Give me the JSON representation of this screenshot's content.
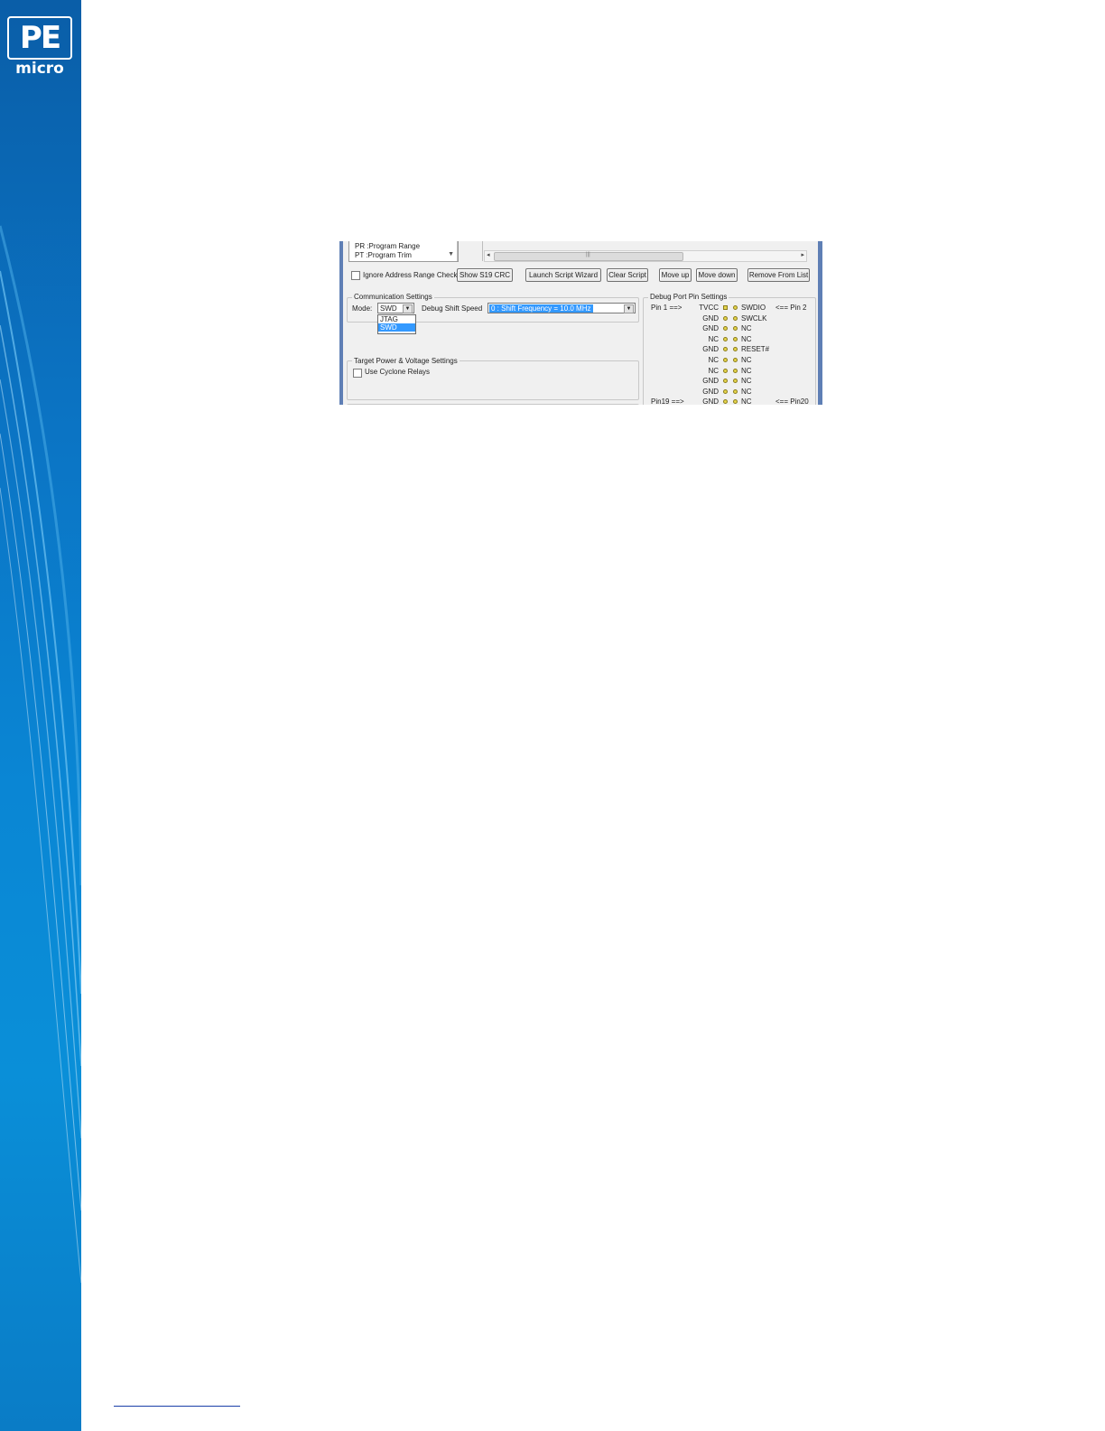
{
  "logo": {
    "top": "PE",
    "bottom": "micro"
  },
  "dialog": {
    "list_items": [
      "PR  :Program Range",
      "PT  :Program Trim"
    ],
    "ignore_range_label": "Ignore Address Range Check",
    "buttons": {
      "show_s19_crc": "Show S19 CRC",
      "launch_wizard": "Launch Script  Wizard",
      "clear_script": "Clear Script",
      "move_up": "Move up",
      "move_down": "Move down",
      "remove_from_list": "Remove From List"
    },
    "comm": {
      "title": "Communication Settings",
      "mode_label": "Mode:",
      "mode_value": "SWD",
      "mode_options": [
        "JTAG",
        "SWD"
      ],
      "speed_label": "Debug Shift Speed",
      "speed_value": "0 : Shift Frequency  = 10.0 MHz"
    },
    "power": {
      "title": "Target Power & Voltage Settings",
      "relays_label": "Use Cyclone Relays"
    },
    "pins": {
      "title": "Debug Port Pin Settings",
      "pin1_label": "Pin 1 ==>",
      "pin19_label": "Pin19 ==>",
      "pin2_label": "<== Pin 2",
      "pin20_label": "<== Pin20",
      "left": [
        "TVCC",
        "GND",
        "GND",
        "NC",
        "GND",
        "NC",
        "NC",
        "GND",
        "GND",
        "GND"
      ],
      "right": [
        "SWDIO",
        "SWCLK",
        "NC",
        "NC",
        "RESET#",
        "NC",
        "NC",
        "NC",
        "NC",
        "NC"
      ]
    }
  }
}
